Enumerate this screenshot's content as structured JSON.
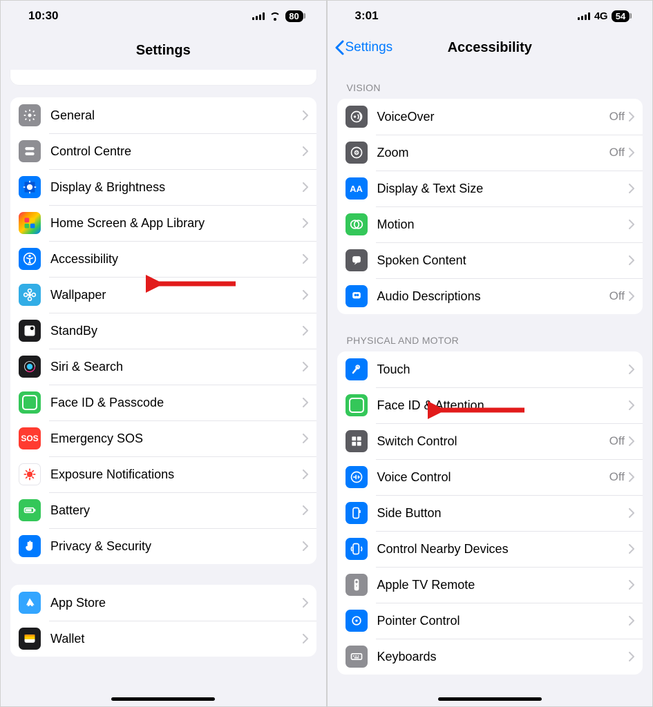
{
  "left": {
    "status": {
      "time": "10:30",
      "battery": "80"
    },
    "title": "Settings",
    "groups": [
      {
        "items": [
          {
            "icon": "gear",
            "bg": "bg-gray",
            "label": "General"
          },
          {
            "icon": "toggles",
            "bg": "bg-gray",
            "label": "Control Centre"
          },
          {
            "icon": "sun",
            "bg": "bg-blue",
            "label": "Display & Brightness"
          },
          {
            "icon": "apps",
            "bg": "bg-multicolor",
            "label": "Home Screen & App Library"
          },
          {
            "icon": "accessibility",
            "bg": "bg-blue",
            "label": "Accessibility"
          },
          {
            "icon": "flower",
            "bg": "bg-cyan",
            "label": "Wallpaper"
          },
          {
            "icon": "standby",
            "bg": "bg-black",
            "label": "StandBy"
          },
          {
            "icon": "siri",
            "bg": "bg-black",
            "label": "Siri & Search"
          },
          {
            "icon": "faceid",
            "bg": "bg-green",
            "label": "Face ID & Passcode"
          },
          {
            "icon": "sos",
            "bg": "bg-red",
            "label": "Emergency SOS"
          },
          {
            "icon": "virus",
            "bg": "bg-white",
            "label": "Exposure Notifications"
          },
          {
            "icon": "battery",
            "bg": "bg-green",
            "label": "Battery"
          },
          {
            "icon": "hand",
            "bg": "bg-blue",
            "label": "Privacy & Security"
          }
        ]
      },
      {
        "items": [
          {
            "icon": "appstore",
            "bg": "bg-lightblue",
            "label": "App Store"
          },
          {
            "icon": "wallet",
            "bg": "bg-black",
            "label": "Wallet"
          }
        ]
      }
    ]
  },
  "right": {
    "status": {
      "time": "3:01",
      "network": "4G",
      "battery": "54"
    },
    "back": "Settings",
    "title": "Accessibility",
    "groups": [
      {
        "title": "VISION",
        "items": [
          {
            "icon": "voiceover",
            "bg": "bg-darkgray",
            "label": "VoiceOver",
            "value": "Off"
          },
          {
            "icon": "zoom",
            "bg": "bg-darkgray",
            "label": "Zoom",
            "value": "Off"
          },
          {
            "icon": "textsize",
            "bg": "bg-blue",
            "label": "Display & Text Size"
          },
          {
            "icon": "motion",
            "bg": "bg-green",
            "label": "Motion"
          },
          {
            "icon": "spoken",
            "bg": "bg-darkgray",
            "label": "Spoken Content"
          },
          {
            "icon": "audiodesc",
            "bg": "bg-blue",
            "label": "Audio Descriptions",
            "value": "Off"
          }
        ]
      },
      {
        "title": "PHYSICAL AND MOTOR",
        "items": [
          {
            "icon": "touch",
            "bg": "bg-blue",
            "label": "Touch"
          },
          {
            "icon": "faceid",
            "bg": "bg-green",
            "label": "Face ID & Attention"
          },
          {
            "icon": "switchctrl",
            "bg": "bg-darkgray",
            "label": "Switch Control",
            "value": "Off"
          },
          {
            "icon": "voicectrl",
            "bg": "bg-blue",
            "label": "Voice Control",
            "value": "Off"
          },
          {
            "icon": "sidebutton",
            "bg": "bg-blue",
            "label": "Side Button"
          },
          {
            "icon": "nearby",
            "bg": "bg-blue",
            "label": "Control Nearby Devices"
          },
          {
            "icon": "atvremote",
            "bg": "bg-gray",
            "label": "Apple TV Remote"
          },
          {
            "icon": "pointer",
            "bg": "bg-blue",
            "label": "Pointer Control"
          },
          {
            "icon": "keyboard",
            "bg": "bg-gray",
            "label": "Keyboards"
          }
        ]
      }
    ]
  }
}
